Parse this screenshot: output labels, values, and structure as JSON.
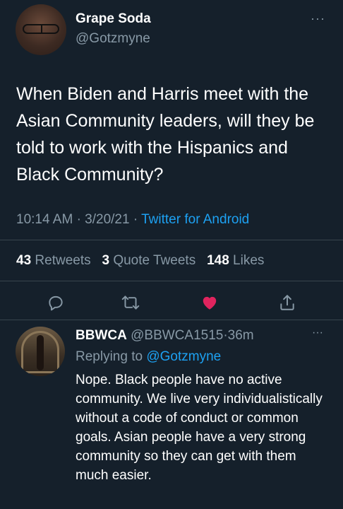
{
  "tweet": {
    "display_name": "Grape Soda",
    "handle": "@Gotzmyne",
    "more": "···",
    "text": "When Biden and Harris meet with the Asian Community leaders, will they be told to work with the Hispanics and Black Community?",
    "time": "10:14 AM",
    "date": "3/20/21",
    "sep": "·",
    "source": "Twitter for Android",
    "retweets_count": "43",
    "retweets_label": "Retweets",
    "quotes_count": "3",
    "quotes_label": "Quote Tweets",
    "likes_count": "148",
    "likes_label": "Likes"
  },
  "actions": {
    "icons": [
      "reply-icon",
      "retweet-icon",
      "like-icon",
      "share-icon"
    ],
    "like_color": "#e0245e",
    "icon_color": "#8899a6"
  },
  "reply": {
    "display_name": "BBWCA",
    "handle": "@BBWCA1515",
    "sep": "·",
    "age": "36m",
    "more": "···",
    "replying_label": "Replying to",
    "replying_to": "@Gotzmyne",
    "text": "Nope. Black people have no active community. We live very individualistically without a code of conduct or common goals. Asian people have a very strong community so they can get with them much easier."
  },
  "colors": {
    "background": "#15202b",
    "muted": "#8899a6",
    "link": "#1da1f2",
    "divider": "#38444d"
  }
}
